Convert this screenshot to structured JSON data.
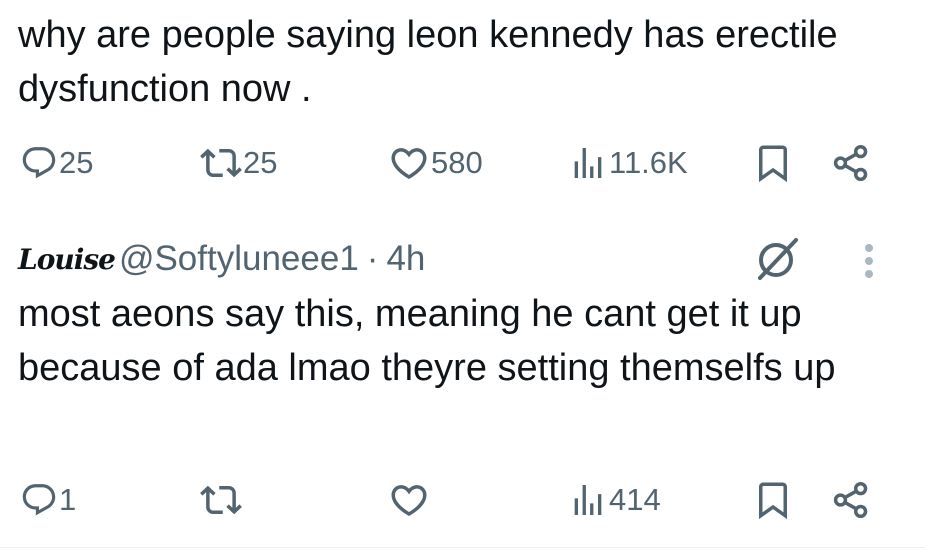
{
  "tweet": {
    "text": "why are people saying leon kennedy has erectile dysfunction now .",
    "actions": {
      "replies": "25",
      "reposts": "25",
      "likes": "580",
      "views": "11.6K"
    }
  },
  "reply": {
    "display_name": "Louise",
    "handle": "@Softyluneee1",
    "separator": "·",
    "time": "4h",
    "text": "most aeons say this, meaning he cant get it up because of ada lmao theyre setting themselfs up",
    "actions": {
      "replies": "1",
      "reposts": "",
      "likes": "",
      "views": "414"
    }
  },
  "colors": {
    "text": "#0f1419",
    "secondary": "#536471",
    "divider": "#eff3f4"
  },
  "icons": [
    "reply-icon",
    "repost-icon",
    "like-icon",
    "views-icon",
    "bookmark-icon",
    "share-icon",
    "grok-icon",
    "more-icon"
  ]
}
